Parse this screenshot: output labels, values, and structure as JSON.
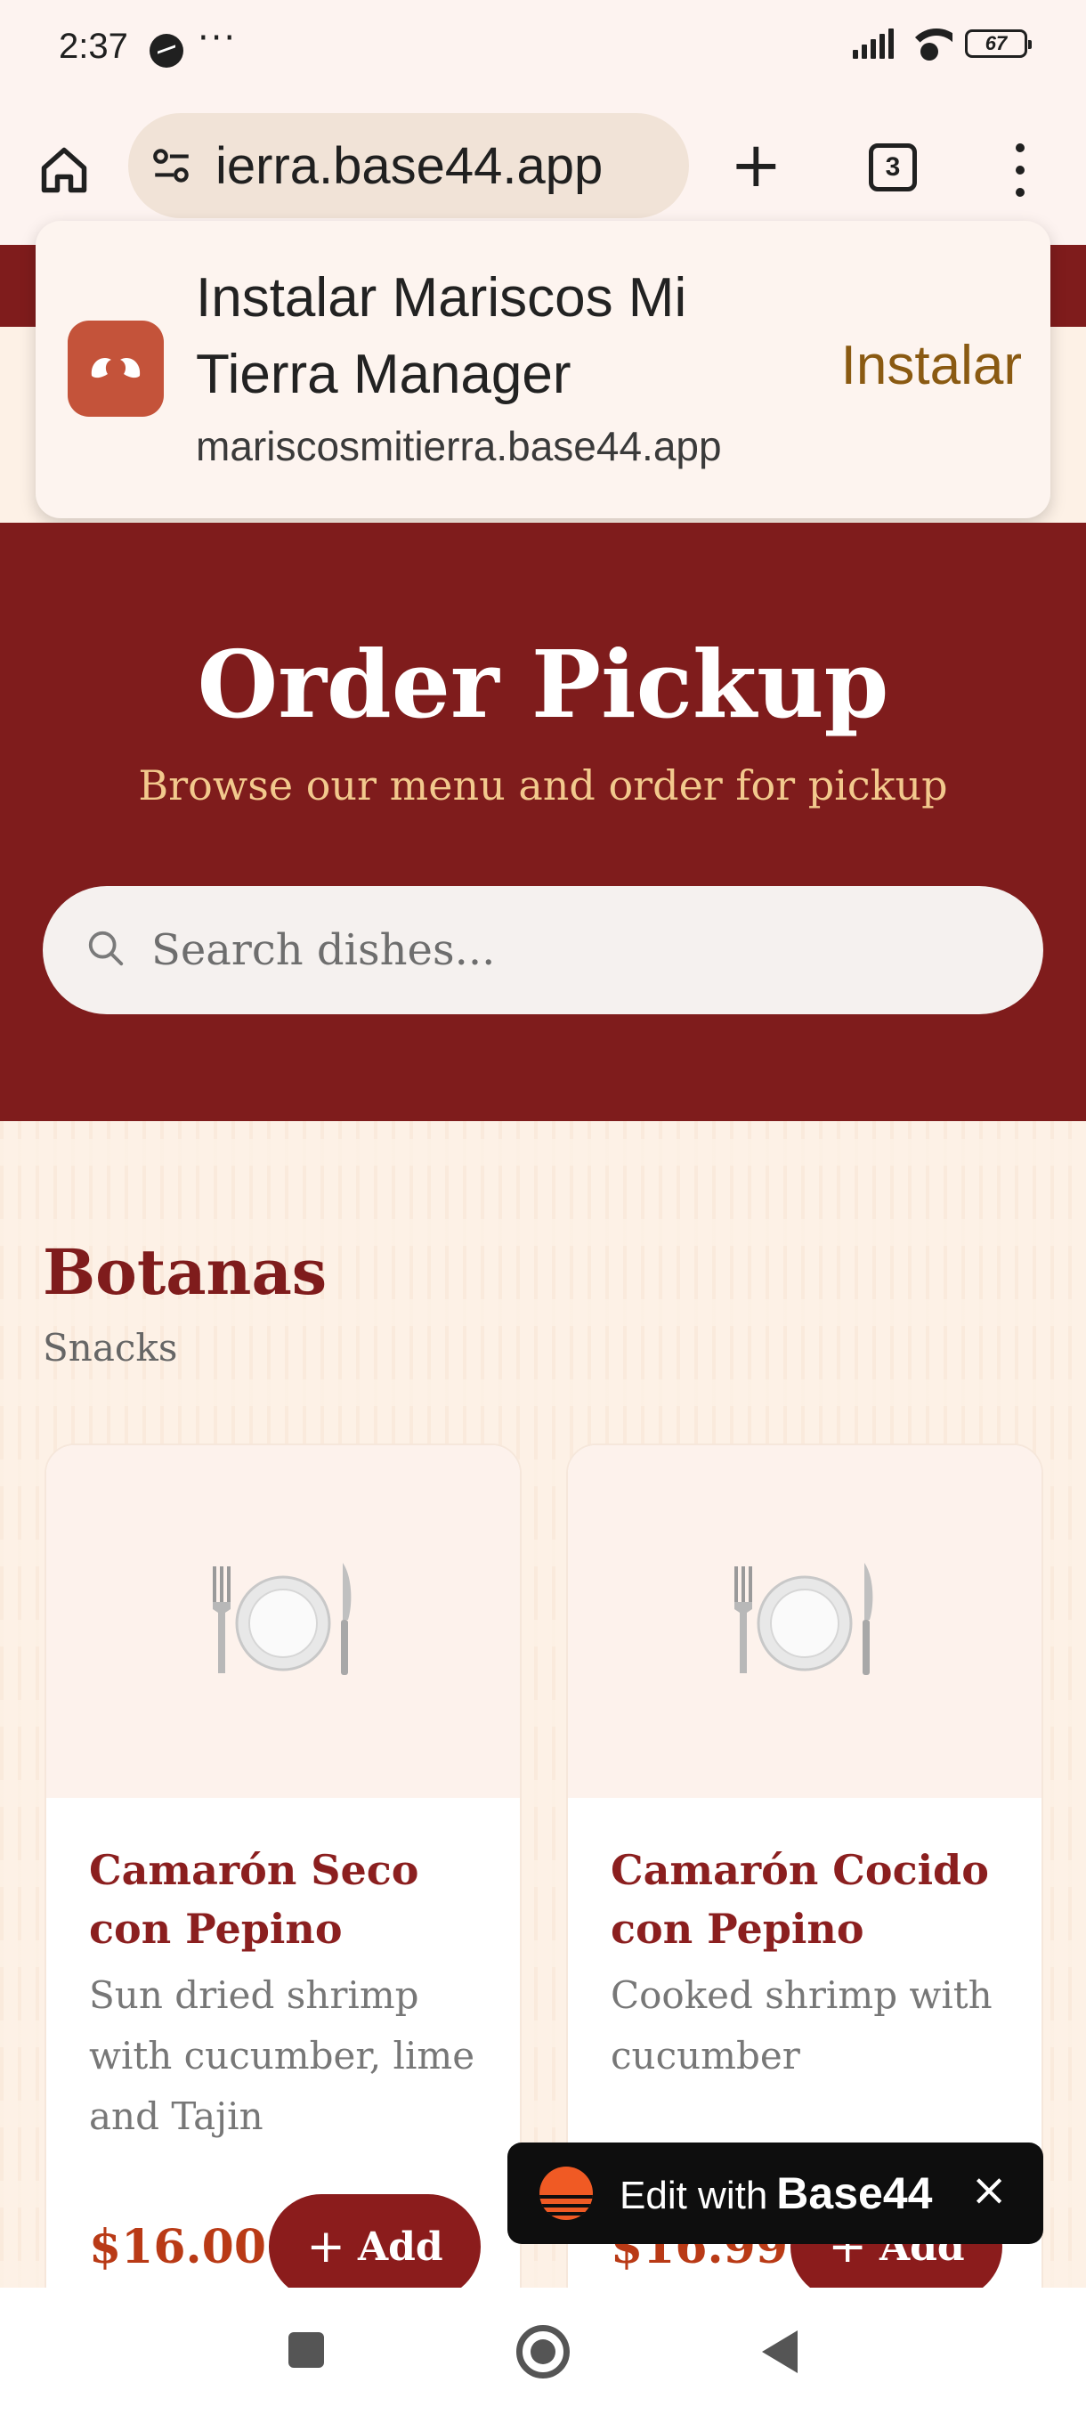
{
  "status_bar": {
    "time": "2:37",
    "notification_icon": "messenger-icon",
    "more": "···",
    "battery": "67"
  },
  "browser": {
    "url_display": "ierra.base44.app",
    "tab_count": "3",
    "icons": [
      "home-icon",
      "site-settings-icon",
      "new-tab-icon",
      "tabs-icon",
      "menu-icon"
    ]
  },
  "install_prompt": {
    "title": "Instalar Mariscos Mi Tierra Manager",
    "url": "mariscosmitierra.base44.app",
    "button": "Instalar",
    "app_icon_color": "#c4533a"
  },
  "hero": {
    "title": "Order Pickup",
    "subtitle": "Browse our menu and order for pickup",
    "search_placeholder": "Search dishes..."
  },
  "section": {
    "title": "Botanas",
    "subtitle": "Snacks"
  },
  "menu_items": [
    {
      "name": "Camarón Seco con Pepino",
      "description": "Sun dried shrimp with cucumber, lime and Tajin",
      "price": "$16.00",
      "add_label": "Add",
      "image_icon": "plate-icon"
    },
    {
      "name": "Camarón Cocido con Pepino",
      "description": "Cooked shrimp with cucumber",
      "price": "$16.99",
      "add_label": "Add",
      "image_icon": "plate-icon"
    }
  ],
  "base44_badge": {
    "prefix": "Edit with",
    "brand": "Base44",
    "close": "×"
  },
  "colors": {
    "brand_red": "#7f1c1c",
    "accent_gold": "#f2c98d",
    "price_orange": "#b93a16",
    "install_gold": "#8a5a12"
  }
}
